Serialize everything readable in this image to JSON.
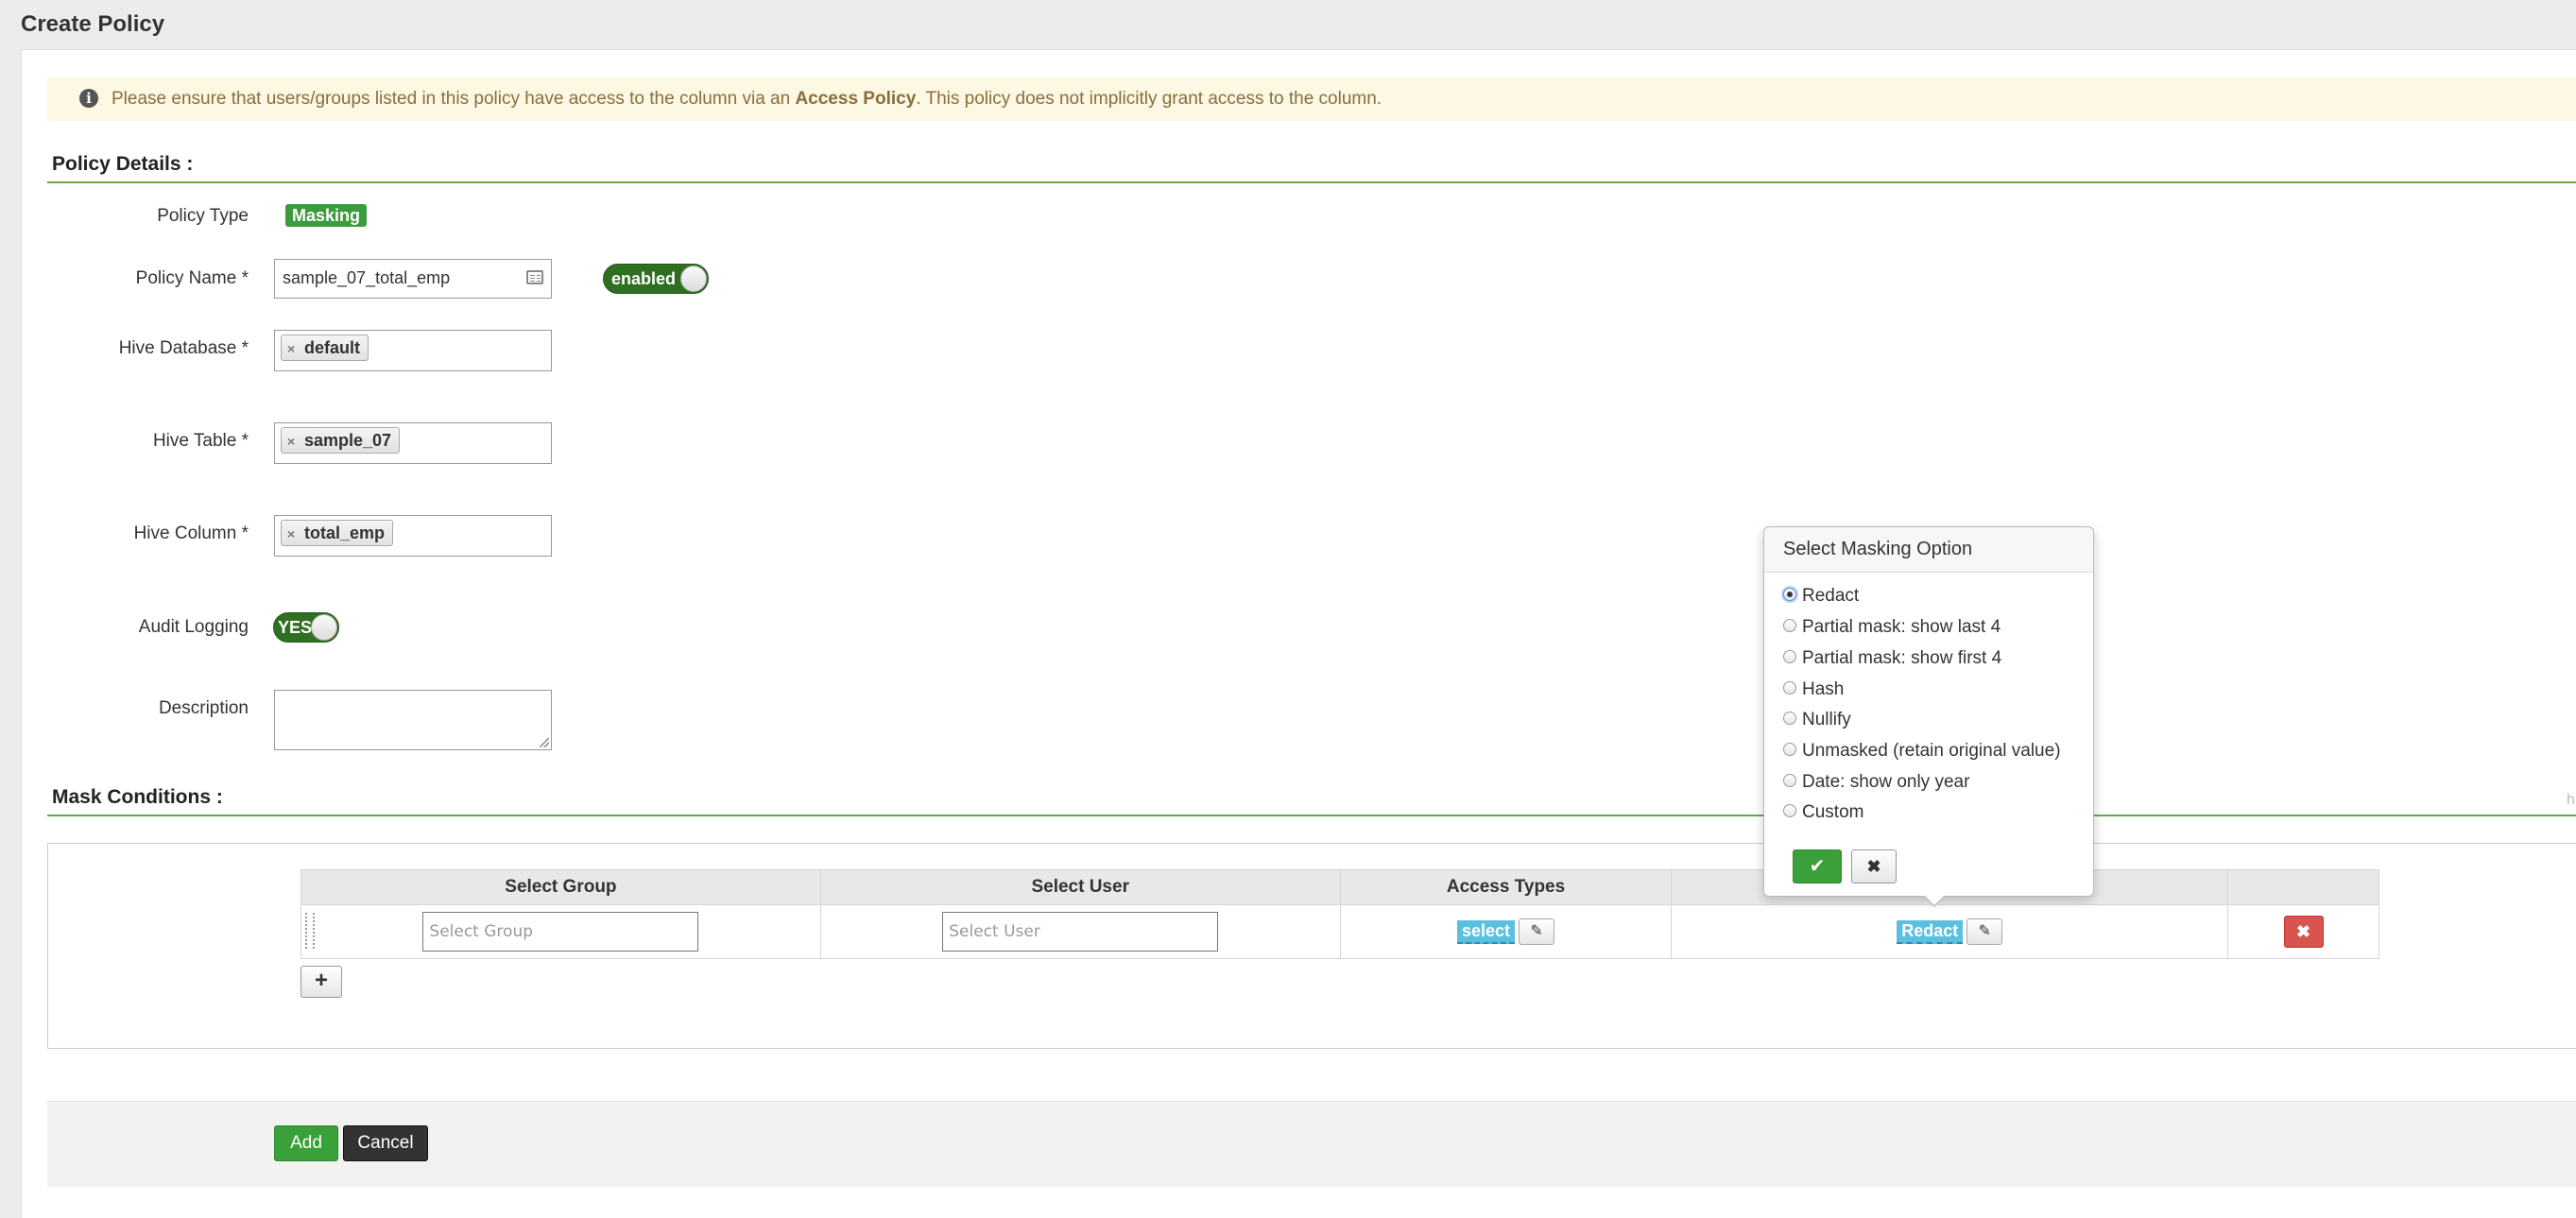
{
  "page": {
    "title": "Create Policy"
  },
  "alert": {
    "text_before": "Please ensure that users/groups listed in this policy have access to the column via an ",
    "bold": "Access Policy",
    "text_after": ". This policy does not implicitly grant access to the column.",
    "icon": "info-icon"
  },
  "policy_details": {
    "heading": "Policy Details :",
    "policy_type_label": "Policy Type",
    "policy_type_value": "Masking",
    "policy_name_label": "Policy Name *",
    "policy_name_value": "sample_07_total_emp",
    "enabled_toggle": "enabled",
    "hive_database_label": "Hive Database *",
    "hive_database_tag": "default",
    "hive_table_label": "Hive Table *",
    "hive_table_tag": "sample_07",
    "hive_column_label": "Hive Column *",
    "hive_column_tag": "total_emp",
    "audit_logging_label": "Audit Logging",
    "audit_logging_toggle": "YES",
    "description_label": "Description",
    "tag_remove": "×"
  },
  "mask_conditions": {
    "heading": "Mask Conditions :",
    "columns": [
      "Select Group",
      "Select User",
      "Access Types",
      "",
      ""
    ],
    "row": {
      "group_placeholder": "Select Group",
      "user_placeholder": "Select User",
      "access_chip": "select",
      "mask_chip": "Redact",
      "delete": "✖"
    },
    "add_row": "+"
  },
  "masking_popover": {
    "title": "Select Masking Option",
    "selected": "Redact",
    "options": [
      "Redact",
      "Partial mask: show last 4",
      "Partial mask: show first 4",
      "Hash",
      "Nullify",
      "Unmasked (retain original value)",
      "Date: show only year",
      "Custom"
    ],
    "ok": "✔",
    "cancel": "✖"
  },
  "footer": {
    "add": "Add",
    "cancel": "Cancel"
  },
  "edge_mark": "h",
  "colors": {
    "accent_green": "#3aa03a",
    "section_rule": "#69a84f",
    "alert_bg": "#fcf8e3",
    "chip_blue": "#5bc0de",
    "danger": "#d9534f"
  }
}
